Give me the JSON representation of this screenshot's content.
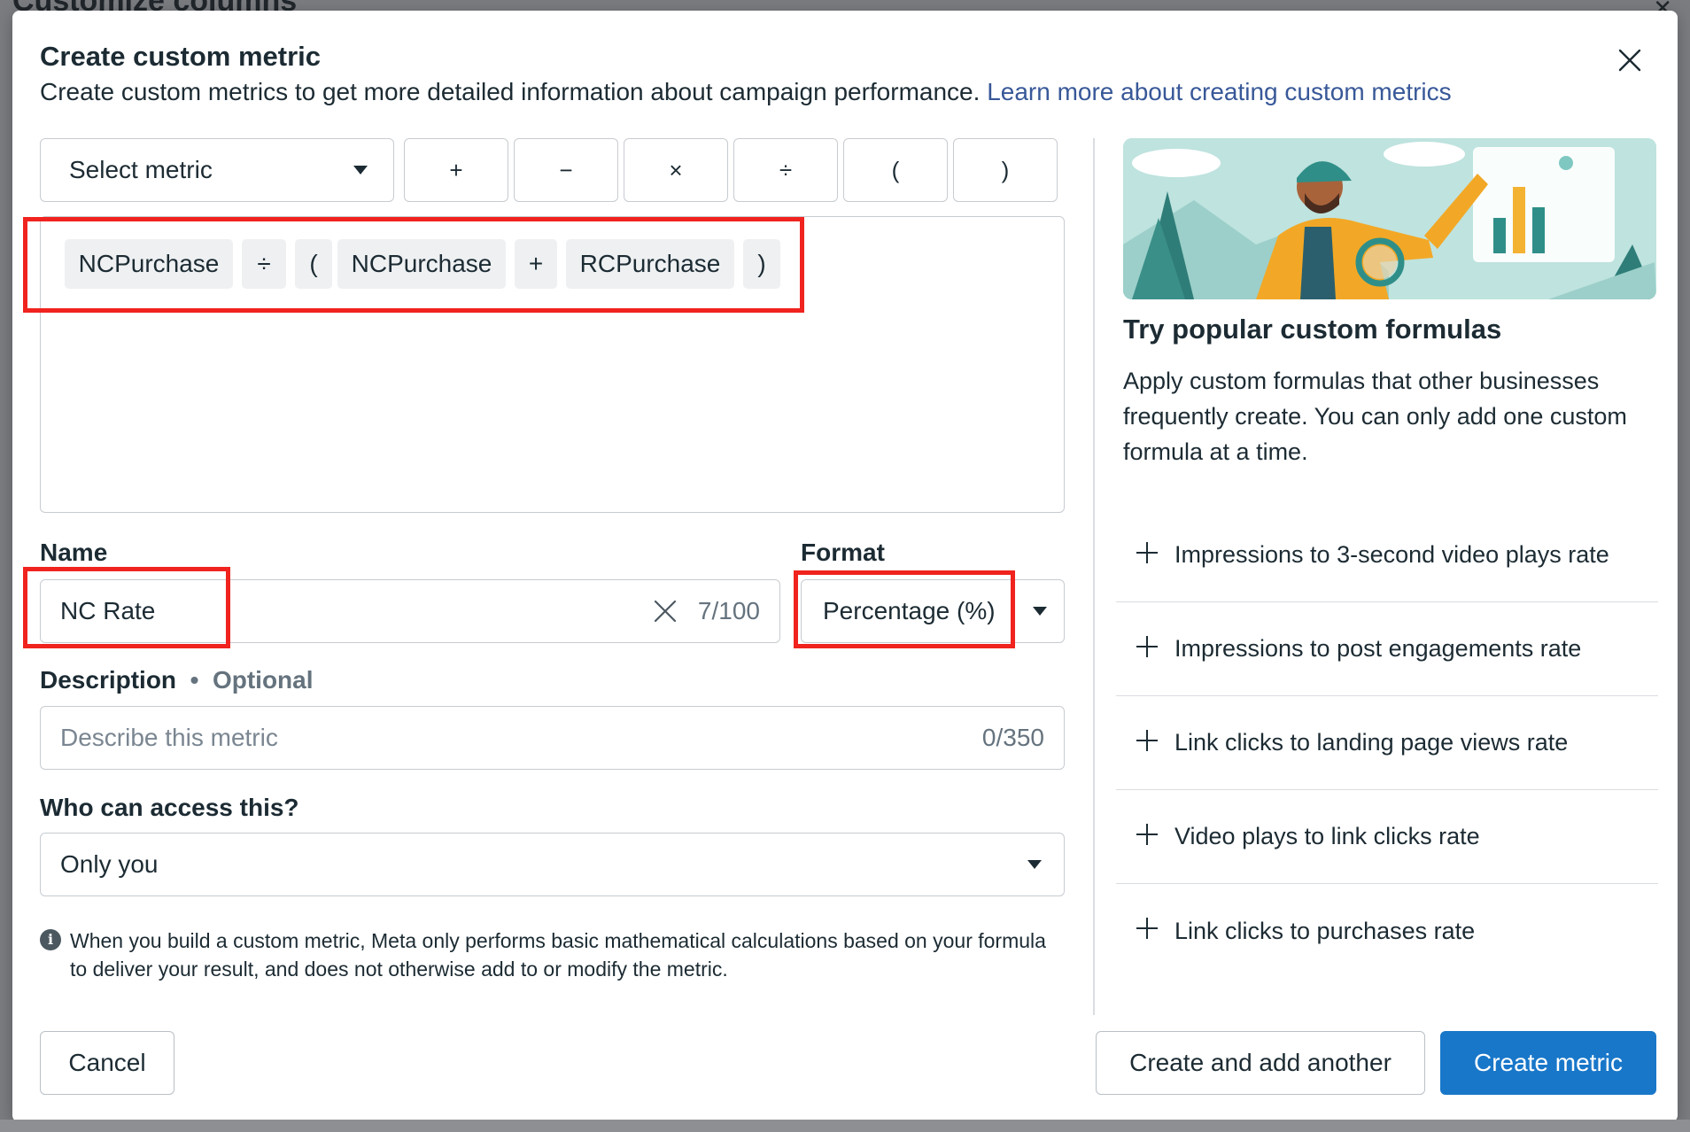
{
  "backdrop": {
    "title": "Customize columns"
  },
  "modal": {
    "title": "Create custom metric",
    "subtitle": "Create custom metrics to get more detailed information about campaign performance.",
    "learn_more": "Learn more about creating custom metrics"
  },
  "formula_builder": {
    "select_metric_label": "Select metric",
    "operators": [
      "+",
      "−",
      "×",
      "÷",
      "(",
      ")"
    ],
    "tokens": [
      "NCPurchase",
      "÷",
      "(",
      "NCPurchase",
      "+",
      "RCPurchase",
      ")"
    ]
  },
  "name_field": {
    "label": "Name",
    "value": "NC Rate",
    "char_count": "7/100"
  },
  "format_field": {
    "label": "Format",
    "value": "Percentage (%)"
  },
  "description_field": {
    "label": "Description",
    "optional": "Optional",
    "placeholder": "Describe this metric",
    "char_count": "0/350"
  },
  "access_field": {
    "label": "Who can access this?",
    "value": "Only you"
  },
  "info_note": "When you build a custom metric, Meta only performs basic mathematical calculations based on your formula to deliver your result, and does not otherwise add to or modify the metric.",
  "popular": {
    "title": "Try popular custom formulas",
    "description": "Apply custom formulas that other businesses frequently create. You can only add one custom formula at a time.",
    "items": [
      "Impressions to 3-second video plays rate",
      "Impressions to post engagements rate",
      "Link clicks to landing page views rate",
      "Video plays to link clicks rate",
      "Link clicks to purchases rate"
    ]
  },
  "footer": {
    "cancel": "Cancel",
    "create_another": "Create and add another",
    "create": "Create metric"
  },
  "colors": {
    "primary": "#1877c9",
    "link": "#385898",
    "highlight": "#f0231e",
    "border": "#c7ccd1"
  }
}
